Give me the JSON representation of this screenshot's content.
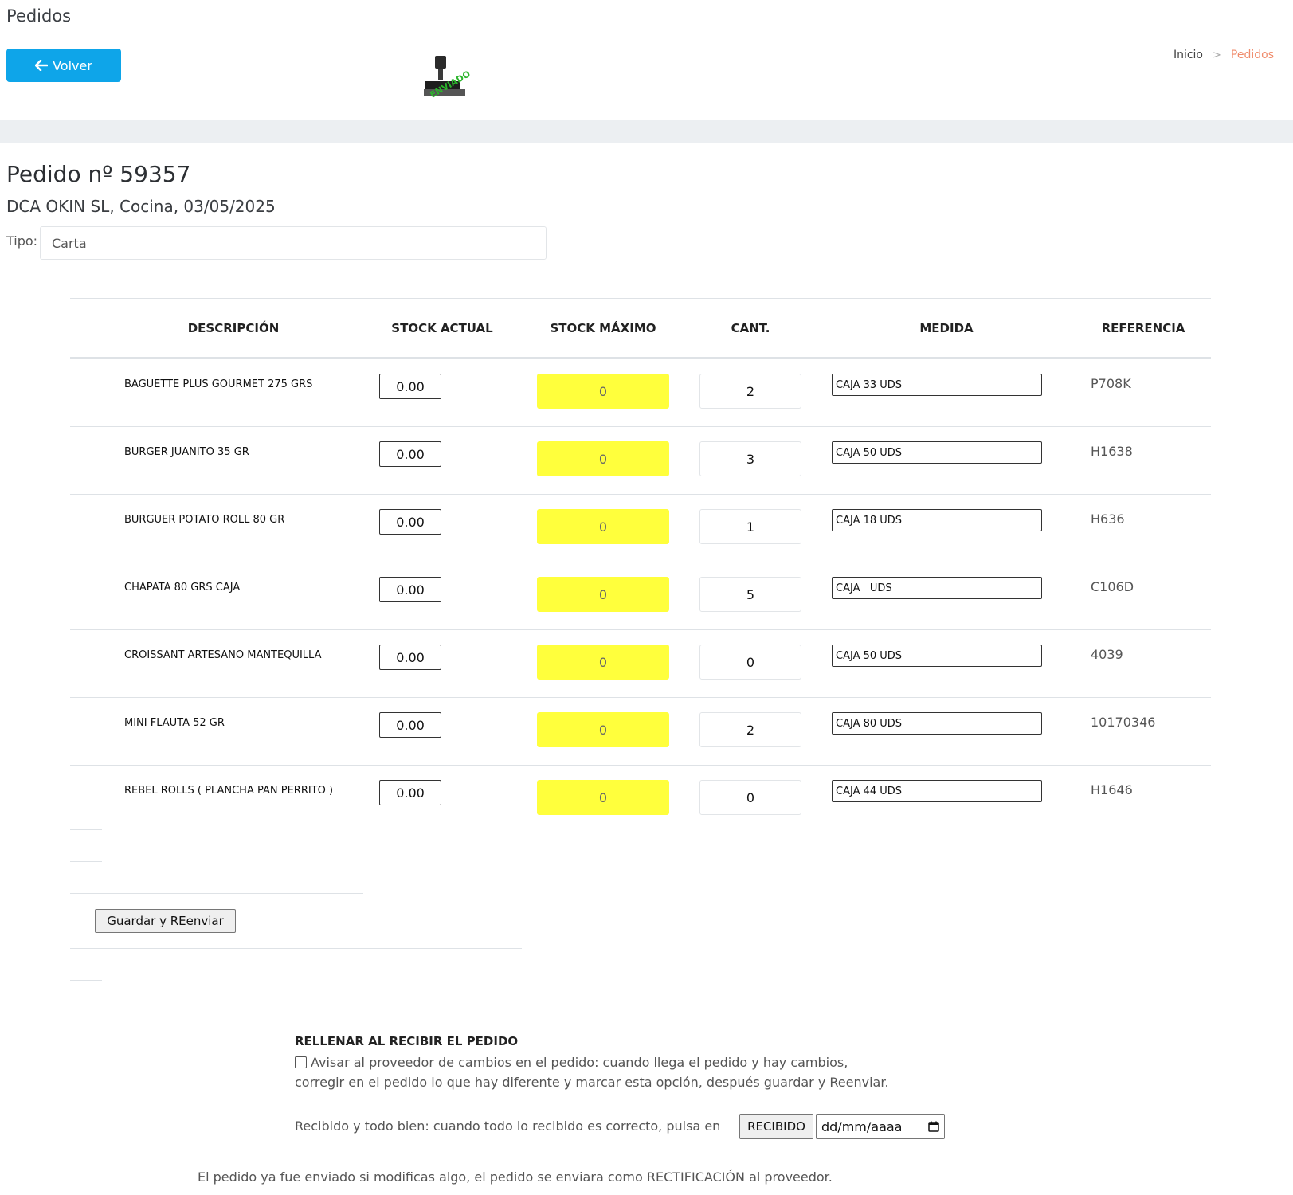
{
  "header": {
    "page_title": "Pedidos",
    "back_label": "Volver",
    "stamp_text": "ENVIADO",
    "breadcrumb": {
      "home": "Inicio",
      "current": "Pedidos"
    }
  },
  "order": {
    "title": "Pedido nº 59357",
    "subtitle": "DCA OKIN SL, Cocina, 03/05/2025",
    "tipo_label": "Tipo:",
    "tipo_value": "Carta"
  },
  "table": {
    "headers": [
      "DESCRIPCIÓN",
      "STOCK ACTUAL",
      "STOCK MÁXIMO",
      "CANT.",
      "MEDIDA",
      "REFERENCIA"
    ],
    "rows": [
      {
        "desc": "BAGUETTE PLUS GOURMET  275 GRS",
        "stock": "0.00",
        "max": "0",
        "cant": "2",
        "medida": "CAJA 33 UDS",
        "ref": "P708K"
      },
      {
        "desc": "BURGER JUANITO  35 GR",
        "stock": "0.00",
        "max": "0",
        "cant": "3",
        "medida": "CAJA 50 UDS",
        "ref": "H1638"
      },
      {
        "desc": "BURGUER POTATO ROLL  80 GR",
        "stock": "0.00",
        "max": "0",
        "cant": "1",
        "medida": "CAJA 18 UDS",
        "ref": "H636"
      },
      {
        "desc": "CHAPATA 80 GRS CAJA",
        "stock": "0.00",
        "max": "0",
        "cant": "5",
        "medida": "CAJA   UDS",
        "ref": "C106D"
      },
      {
        "desc": "CROISSANT ARTESANO MANTEQUILLA",
        "stock": "0.00",
        "max": "0",
        "cant": "0",
        "medida": "CAJA 50 UDS",
        "ref": "4039"
      },
      {
        "desc": "MINI FLAUTA 52 GR",
        "stock": "0.00",
        "max": "0",
        "cant": "2",
        "medida": "CAJA 80 UDS",
        "ref": "10170346"
      },
      {
        "desc": "REBEL ROLLS ( PLANCHA PAN PERRITO )",
        "stock": "0.00",
        "max": "0",
        "cant": "0",
        "medida": "CAJA 44 UDS",
        "ref": "H1646"
      }
    ]
  },
  "actions": {
    "save_label": "Guardar y REenviar"
  },
  "receive": {
    "title": "RELLENAR AL RECIBIR EL PEDIDO",
    "notify_line1": "Avisar al proveedor de cambios en el pedido: cuando llega el pedido y hay cambios,",
    "notify_line2": "corregir en el pedido lo que hay diferente y marcar esta opción, después guardar y Reenviar.",
    "ok_text": "Recibido y todo bien: cuando todo lo recibido es correcto, pulsa en",
    "recibido_label": "RECIBIDO",
    "date_placeholder": "dd/mm/aaaa",
    "footer_note": "El pedido ya fue enviado si modificas algo, el pedido se enviara como RECTIFICACIÓN al proveedor."
  },
  "colors": {
    "primary": "#0ea5e9",
    "breadcrumb_active": "#f08c6c",
    "max_highlight": "#ffff3c"
  },
  "icons": {
    "back": "arrow-left-icon",
    "stamp": "stamp-icon",
    "calendar": "calendar-icon",
    "breadcrumb_sep": "chevron-right-icon"
  }
}
